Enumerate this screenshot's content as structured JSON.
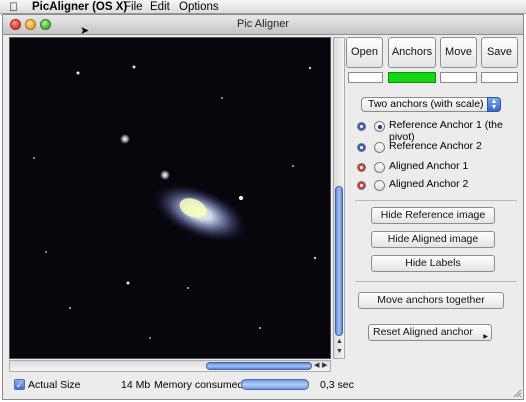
{
  "menubar": {
    "app_name": "PicAligner (OS X)",
    "items": [
      "File",
      "Edit",
      "Options"
    ]
  },
  "window": {
    "title": "Pic Aligner"
  },
  "toolbar": {
    "buttons": [
      "Open",
      "Anchors",
      "Move",
      "Save"
    ],
    "active_indicator": "Anchors",
    "indicator_color": "#11d611"
  },
  "anchor_mode": {
    "selected": "Two anchors (with scale)"
  },
  "anchors": [
    {
      "label": "Reference Anchor 1 (the pivot)",
      "color": "blue",
      "checked": true
    },
    {
      "label": "Reference Anchor 2",
      "color": "blue",
      "checked": false
    },
    {
      "label": "Aligned Anchor 1",
      "color": "red",
      "checked": false
    },
    {
      "label": "Aligned Anchor 2",
      "color": "red",
      "checked": false
    }
  ],
  "actions": {
    "hide_reference": "Hide Reference image",
    "hide_aligned": "Hide Aligned image",
    "hide_labels": "Hide Labels",
    "move_together": "Move anchors together",
    "reset_aligned": "Reset Aligned anchor"
  },
  "status": {
    "actual_size_label": "Actual Size",
    "actual_size_checked": true,
    "memory_amount": "14 Mb",
    "memory_label": "Memory consumed",
    "time": "0,3 sec"
  }
}
